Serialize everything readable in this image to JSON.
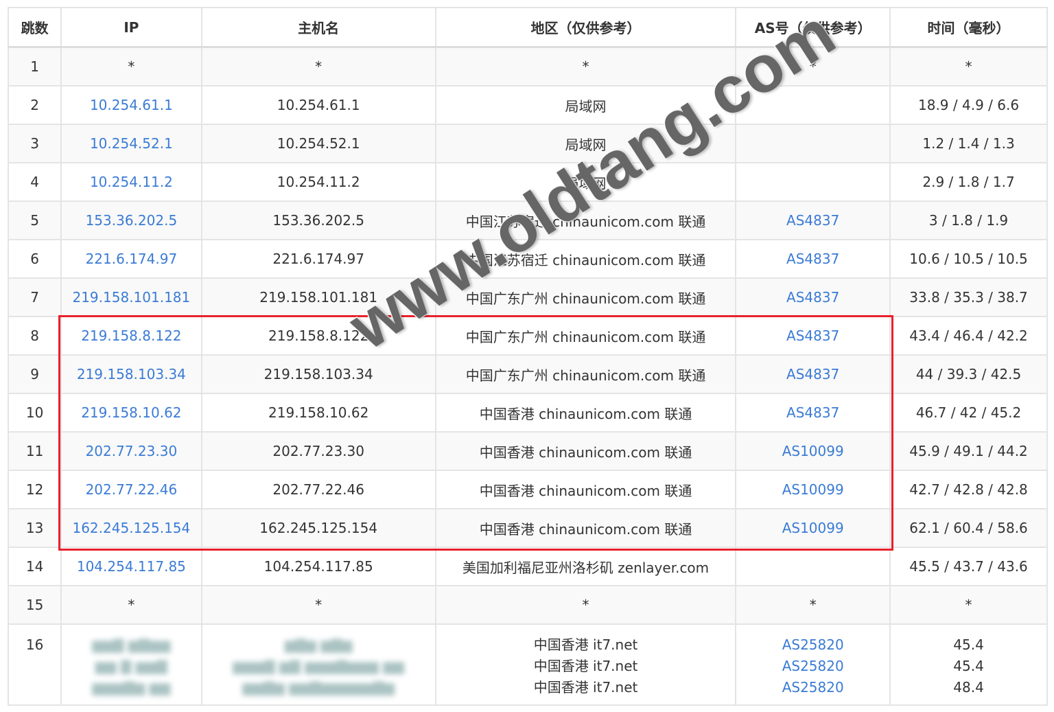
{
  "headers": [
    "跳数",
    "IP",
    "主机名",
    "地区（仅供参考）",
    "AS号（仅供参考）",
    "时间（毫秒）"
  ],
  "rows": [
    {
      "hop": "1",
      "ip": "*",
      "host": "*",
      "region": "*",
      "as": "*",
      "time": "*"
    },
    {
      "hop": "2",
      "ip": "10.254.61.1",
      "host": "10.254.61.1",
      "region": "局域网",
      "as": "",
      "time": "18.9 / 4.9 / 6.6"
    },
    {
      "hop": "3",
      "ip": "10.254.52.1",
      "host": "10.254.52.1",
      "region": "局域网",
      "as": "",
      "time": "1.2 / 1.4 / 1.3"
    },
    {
      "hop": "4",
      "ip": "10.254.11.2",
      "host": "10.254.11.2",
      "region": "局域网",
      "as": "",
      "time": "2.9 / 1.8 / 1.7"
    },
    {
      "hop": "5",
      "ip": "153.36.202.5",
      "host": "153.36.202.5",
      "region": "中国江苏宿迁 chinaunicom.com 联通",
      "as": "AS4837",
      "time": "3 / 1.8 / 1.9"
    },
    {
      "hop": "6",
      "ip": "221.6.174.97",
      "host": "221.6.174.97",
      "region": "中国江苏宿迁 chinaunicom.com 联通",
      "as": "AS4837",
      "time": "10.6 / 10.5 / 10.5"
    },
    {
      "hop": "7",
      "ip": "219.158.101.181",
      "host": "219.158.101.181",
      "region": "中国广东广州 chinaunicom.com 联通",
      "as": "AS4837",
      "time": "33.8 / 35.3 / 38.7"
    },
    {
      "hop": "8",
      "ip": "219.158.8.122",
      "host": "219.158.8.122",
      "region": "中国广东广州 chinaunicom.com 联通",
      "as": "AS4837",
      "time": "43.4 / 46.4 / 42.2"
    },
    {
      "hop": "9",
      "ip": "219.158.103.34",
      "host": "219.158.103.34",
      "region": "中国广东广州 chinaunicom.com 联通",
      "as": "AS4837",
      "time": "44 / 39.3 / 42.5"
    },
    {
      "hop": "10",
      "ip": "219.158.10.62",
      "host": "219.158.10.62",
      "region": "中国香港 chinaunicom.com 联通",
      "as": "AS4837",
      "time": "46.7 / 42 / 45.2"
    },
    {
      "hop": "11",
      "ip": "202.77.23.30",
      "host": "202.77.23.30",
      "region": "中国香港 chinaunicom.com 联通",
      "as": "AS10099",
      "time": "45.9 / 49.1 / 44.2"
    },
    {
      "hop": "12",
      "ip": "202.77.22.46",
      "host": "202.77.22.46",
      "region": "中国香港 chinaunicom.com 联通",
      "as": "AS10099",
      "time": "42.7 / 42.8 / 42.8"
    },
    {
      "hop": "13",
      "ip": "162.245.125.154",
      "host": "162.245.125.154",
      "region": "中国香港 chinaunicom.com 联通",
      "as": "AS10099",
      "time": "62.1 / 60.4 / 58.6"
    },
    {
      "hop": "14",
      "ip": "104.254.117.85",
      "host": "104.254.117.85",
      "region": "美国加利福尼亚州洛杉矶 zenlayer.com",
      "as": "",
      "time": "45.5 / 43.7 / 43.6"
    },
    {
      "hop": "15",
      "ip": "*",
      "host": "*",
      "region": "*",
      "as": "*",
      "time": "*"
    }
  ],
  "last_row": {
    "hop": "16",
    "regions": [
      "中国香港 it7.net",
      "中国香港 it7.net",
      "中国香港 it7.net"
    ],
    "as": [
      "AS25820",
      "AS25820",
      "AS25820"
    ],
    "times": [
      "45.4",
      "45.4",
      "48.4"
    ]
  },
  "watermark": "www.oldtang.com"
}
